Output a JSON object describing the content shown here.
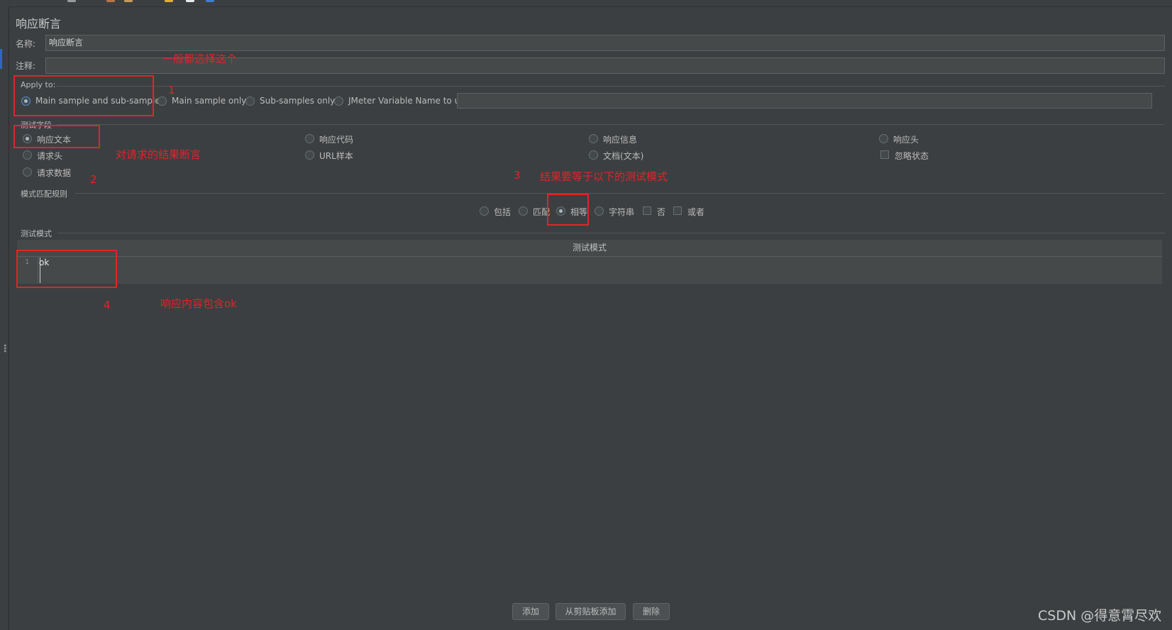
{
  "panel": {
    "title": "响应断言"
  },
  "name_row": {
    "label": "名称:",
    "value": "响应断言"
  },
  "comment_row": {
    "label": "注释:",
    "value": ""
  },
  "apply_to": {
    "legend": "Apply to:",
    "options": [
      "Main sample and sub-samples",
      "Main sample only",
      "Sub-samples only",
      "JMeter Variable Name to use"
    ],
    "selected": "Main sample and sub-samples",
    "variable_value": ""
  },
  "test_field": {
    "legend": "测试字段",
    "options": [
      "响应文本",
      "响应代码",
      "响应信息",
      "响应头",
      "请求头",
      "URL样本",
      "文档(文本)",
      "请求数据"
    ],
    "ignore_status_label": "忽略状态",
    "selected": "响应文本"
  },
  "match_rule": {
    "legend": "模式匹配规则",
    "options": [
      "包括",
      "匹配",
      "相等",
      "字符串"
    ],
    "checkboxes": [
      "否",
      "或者"
    ],
    "selected": "相等"
  },
  "patterns": {
    "legend": "测试模式",
    "column_header": "测试模式",
    "rows": [
      {
        "line": "1",
        "text": "ok"
      }
    ]
  },
  "buttons": {
    "add": "添加",
    "add_clipboard": "从剪贴板添加",
    "delete": "删除"
  },
  "annotations": {
    "note1_num": "1",
    "note1_text": "一般都选择这个",
    "note2_num": "2",
    "note2_text": "对请求的结果断言",
    "note3_num": "3",
    "note3_text": "结果要等于以下的测试模式",
    "note4_num": "4",
    "note4_text": "响应内容包含ok"
  },
  "watermark": "CSDN @得意霄尽欢",
  "colors": {
    "background": "#3c3f41",
    "field": "#45494a",
    "annotation_red": "#e0242a",
    "radio_dot": "#a9b7c6"
  }
}
